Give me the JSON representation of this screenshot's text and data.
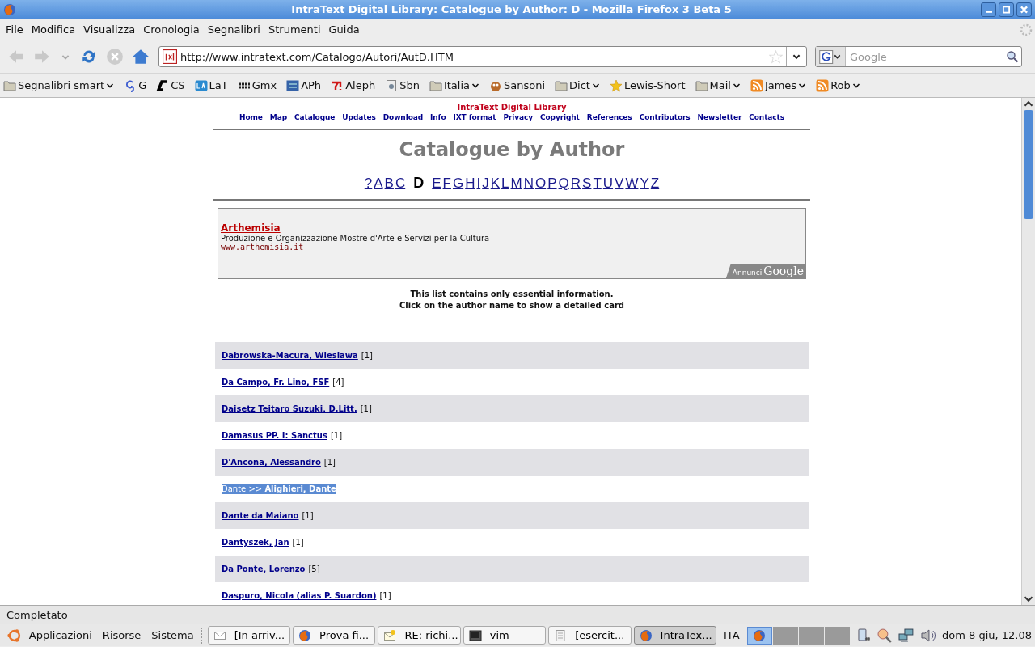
{
  "window": {
    "title": "IntraText Digital Library: Catalogue by Author: D - Mozilla Firefox 3 Beta 5"
  },
  "menu": [
    "File",
    "Modifica",
    "Visualizza",
    "Cronologia",
    "Segnalibri",
    "Strumenti",
    "Guida"
  ],
  "address": {
    "value": "http://www.intratext.com/Catalogo/Autori/AutD.HTM"
  },
  "search": {
    "placeholder": "Google"
  },
  "bookmarks": [
    {
      "label": "Segnalibri smart",
      "kind": "folder",
      "menu": true
    },
    {
      "label": "G",
      "kind": "g",
      "menu": false
    },
    {
      "label": "CS",
      "kind": "cs",
      "menu": false
    },
    {
      "label": "LaT",
      "kind": "lat",
      "menu": false
    },
    {
      "label": "Gmx",
      "kind": "gmx",
      "menu": false
    },
    {
      "label": "APh",
      "kind": "ucla",
      "menu": false
    },
    {
      "label": "Aleph",
      "kind": "yahoo",
      "menu": false
    },
    {
      "label": "Sbn",
      "kind": "page",
      "menu": false
    },
    {
      "label": "Italia",
      "kind": "folder",
      "menu": true
    },
    {
      "label": "Sansoni",
      "kind": "owl",
      "menu": false
    },
    {
      "label": "Dict",
      "kind": "folder",
      "menu": true
    },
    {
      "label": "Lewis-Short",
      "kind": "star",
      "menu": false
    },
    {
      "label": "Mail",
      "kind": "folder",
      "menu": true
    },
    {
      "label": "James",
      "kind": "rss",
      "menu": true
    },
    {
      "label": "Rob",
      "kind": "rss",
      "menu": true
    }
  ],
  "page": {
    "site_title": "IntraText Digital Library",
    "nav": [
      "Home",
      "Map",
      "Catalogue",
      "Updates",
      "Download",
      "Info",
      "IXT format",
      "Privacy",
      "Copyright",
      "References",
      "Contributors",
      "Newsletter",
      "Contacts"
    ],
    "heading": "Catalogue by Author",
    "letters": [
      {
        "label": "?",
        "selected": false
      },
      {
        "label": "A",
        "selected": false
      },
      {
        "label": "B",
        "selected": false
      },
      {
        "label": "C",
        "selected": false
      },
      {
        "label": "D",
        "selected": true
      },
      {
        "label": "E",
        "selected": false
      },
      {
        "label": "F",
        "selected": false
      },
      {
        "label": "G",
        "selected": false
      },
      {
        "label": "H",
        "selected": false
      },
      {
        "label": "I",
        "selected": false
      },
      {
        "label": "J",
        "selected": false
      },
      {
        "label": "K",
        "selected": false
      },
      {
        "label": "L",
        "selected": false
      },
      {
        "label": "M",
        "selected": false
      },
      {
        "label": "N",
        "selected": false
      },
      {
        "label": "O",
        "selected": false
      },
      {
        "label": "P",
        "selected": false
      },
      {
        "label": "Q",
        "selected": false
      },
      {
        "label": "R",
        "selected": false
      },
      {
        "label": "S",
        "selected": false
      },
      {
        "label": "T",
        "selected": false
      },
      {
        "label": "U",
        "selected": false
      },
      {
        "label": "V",
        "selected": false
      },
      {
        "label": "W",
        "selected": false
      },
      {
        "label": "Y",
        "selected": false
      },
      {
        "label": "Z",
        "selected": false
      }
    ],
    "ad": {
      "title": "Arthemisia",
      "text": "Produzione e Organizzazione Mostre d'Arte e Servizi per la Cultura",
      "url": "www.arthemisia.it",
      "badge_small": "Annunci",
      "badge_big": "Google"
    },
    "notice": [
      "This list contains only essential information.",
      "Click on the author name to show a detailed card"
    ],
    "authors": [
      {
        "kind": "entry",
        "name": "Dabrowska-Macura, Wieslawa",
        "count": "[1]"
      },
      {
        "kind": "entry",
        "name": "Da Campo, Fr. Lino, FSF",
        "count": "[4]"
      },
      {
        "kind": "entry",
        "name": "Daisetz Teitaro Suzuki, D.Litt.",
        "count": "[1]"
      },
      {
        "kind": "entry",
        "name": "Damasus PP. I: Sanctus",
        "count": "[1]"
      },
      {
        "kind": "entry",
        "name": "D'Ancona, Alessandro",
        "count": "[1]"
      },
      {
        "kind": "see",
        "prefix": "Dante >>",
        "name": "Alighieri, Dante",
        "highlighted": true
      },
      {
        "kind": "entry",
        "name": "Dante da Maiano",
        "count": "[1]"
      },
      {
        "kind": "entry",
        "name": "Dantyszek, Jan",
        "count": "[1]"
      },
      {
        "kind": "entry",
        "name": "Da Ponte, Lorenzo",
        "count": "[5]"
      },
      {
        "kind": "entry",
        "name": "Daspuro, Nicola (alias P. Suardon)",
        "count": "[1]"
      }
    ]
  },
  "status_bar": "Completato",
  "taskbar": {
    "menus": [
      "Applicazioni",
      "Risorse",
      "Sistema"
    ],
    "tasks": [
      {
        "label": "[In arriv...",
        "kind": "mail",
        "selected": false
      },
      {
        "label": "Prova fi...",
        "kind": "firefox",
        "selected": false
      },
      {
        "label": "RE: richi...",
        "kind": "compose",
        "selected": false
      },
      {
        "label": "vim",
        "kind": "terminal",
        "selected": false
      },
      {
        "label": "[esercit...",
        "kind": "doc",
        "selected": false
      },
      {
        "label": "IntraTex...",
        "kind": "firefox",
        "selected": true
      }
    ],
    "keyboard": "ITA",
    "workspaces": [
      {
        "selected": true
      },
      {
        "selected": false
      },
      {
        "selected": false
      },
      {
        "selected": false
      }
    ],
    "clock": "dom  8 giu, 12.08"
  }
}
